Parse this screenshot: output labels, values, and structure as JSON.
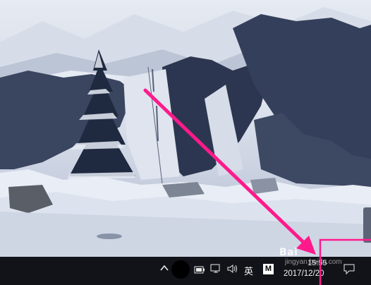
{
  "desktop": {
    "wallpaper": "snowy-mountain-forest",
    "colors": {
      "sky": "#c9d1de",
      "snow": "#e4e8f0",
      "forest": "#2f3a52",
      "shadow": "#8d97b0"
    }
  },
  "taskbar": {
    "background": "#121318",
    "tray": {
      "chevron_icon": "chevron-up-icon",
      "battery_icon": "battery-icon",
      "network_icon": "network-icon",
      "volume_label": "◁))",
      "ime_label": "英",
      "app_badge_label": "M",
      "notification_icon": "notification-icon"
    },
    "clock": {
      "time": "15:55",
      "date": "2017/12/20"
    }
  },
  "annotation": {
    "arrow_color": "#ff1a8c",
    "highlight_color": "#ff1a8c"
  },
  "watermark": {
    "label": "Bai",
    "sub": "jingyan.baidu.com"
  }
}
